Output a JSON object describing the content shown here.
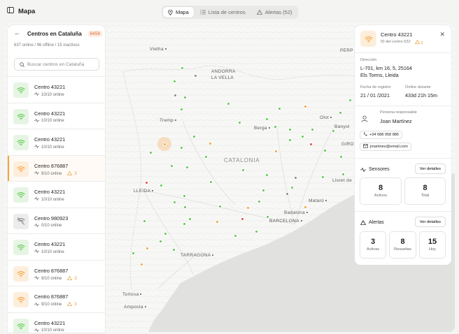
{
  "app": {
    "title": "Mapa"
  },
  "tabs": [
    {
      "label": "Mapa"
    },
    {
      "label": "Lista de centros"
    },
    {
      "label": "Alertas (52)"
    }
  ],
  "sidebar": {
    "title": "Centros en Cataluña",
    "count_badge": "6458",
    "summary": "637 online  /  96 offline  /  15 inactivos",
    "search_placeholder": "Buscar centros en Cataluña",
    "items": [
      {
        "name": "Centro 43221",
        "status": "10/10 online",
        "icon": "wifi-icon",
        "tone": "green",
        "alerts": ""
      },
      {
        "name": "Centro 43221",
        "status": "10/10 online",
        "icon": "wifi-icon",
        "tone": "green",
        "alerts": ""
      },
      {
        "name": "Centro 43221",
        "status": "10/10 online",
        "icon": "wifi-icon",
        "tone": "green",
        "alerts": ""
      },
      {
        "name": "Centro 876887",
        "status": "9/10 online",
        "icon": "wifi-icon",
        "tone": "orange",
        "alerts": "3"
      },
      {
        "name": "Centro 43221",
        "status": "10/10 online",
        "icon": "wifi-icon",
        "tone": "green",
        "alerts": ""
      },
      {
        "name": "Centro 980923",
        "status": "0/10 online",
        "icon": "wifi-off-icon",
        "tone": "gray",
        "alerts": ""
      },
      {
        "name": "Centro 43221",
        "status": "10/10 online",
        "icon": "wifi-icon",
        "tone": "green",
        "alerts": ""
      },
      {
        "name": "Centro 876887",
        "status": "9/10 online",
        "icon": "wifi-icon",
        "tone": "orange",
        "alerts": "3"
      },
      {
        "name": "Centro 876887",
        "status": "9/10 online",
        "icon": "wifi-icon",
        "tone": "orange",
        "alerts": "3"
      },
      {
        "name": "Centro 43221",
        "status": "10/10 online",
        "icon": "wifi-icon",
        "tone": "green",
        "alerts": ""
      }
    ]
  },
  "map": {
    "places": {
      "vielha": "Vielha",
      "andorra": "ANDORRA",
      "andorra2": "LA VELLA",
      "tremp": "Tremp",
      "berga": "Berga",
      "olot": "Olot",
      "banyoles": "Banyol",
      "girona": "GIRO",
      "catalonia": "CATALONIA",
      "lleida": "LLEIDA",
      "lloret": "Lloret de",
      "mataro": "Mataró",
      "badalona": "Badalona",
      "barcelona": "BARCELONA",
      "tarragona": "TARRAGONA",
      "tortosa": "Tortosa",
      "amposta": "Amposta",
      "perpignan": "PERP"
    }
  },
  "detail": {
    "title": "Centro 43221",
    "id_label": "ID del centro 532",
    "alert_count": "3",
    "address_label": "Dirección",
    "address_line1": "L-701, km 16, 5, 25164",
    "address_line2": "Els Torms, Lleida",
    "reg_label": "Fecha de registro",
    "reg_value": "21 / 01 /2021",
    "online_label": "Online durante",
    "online_value": "433d 21h 15m",
    "person_label": "Persona responsable",
    "person_name": "Joan Martínez",
    "phone": "+34 688 958 886",
    "email": "jmartinez@email.com",
    "sensors_title": "Sensores",
    "sensors_button": "Ver detalles",
    "sensors_active": "8",
    "sensors_active_label": "Activos",
    "sensors_total": "8",
    "sensors_total_label": "Total",
    "alerts_title": "Alertas",
    "alerts_button": "Ver detalles",
    "alerts_active": "3",
    "alerts_active_label": "Activas",
    "alerts_resolved": "8",
    "alerts_resolved_label": "Resueltas",
    "alerts_today": "15",
    "alerts_today_label": "Hoy"
  },
  "colors": {
    "online": "#5cc94c",
    "warning": "#f5a23a",
    "error": "#e54b4b",
    "offline": "#888888",
    "accent": "#e0703a"
  }
}
